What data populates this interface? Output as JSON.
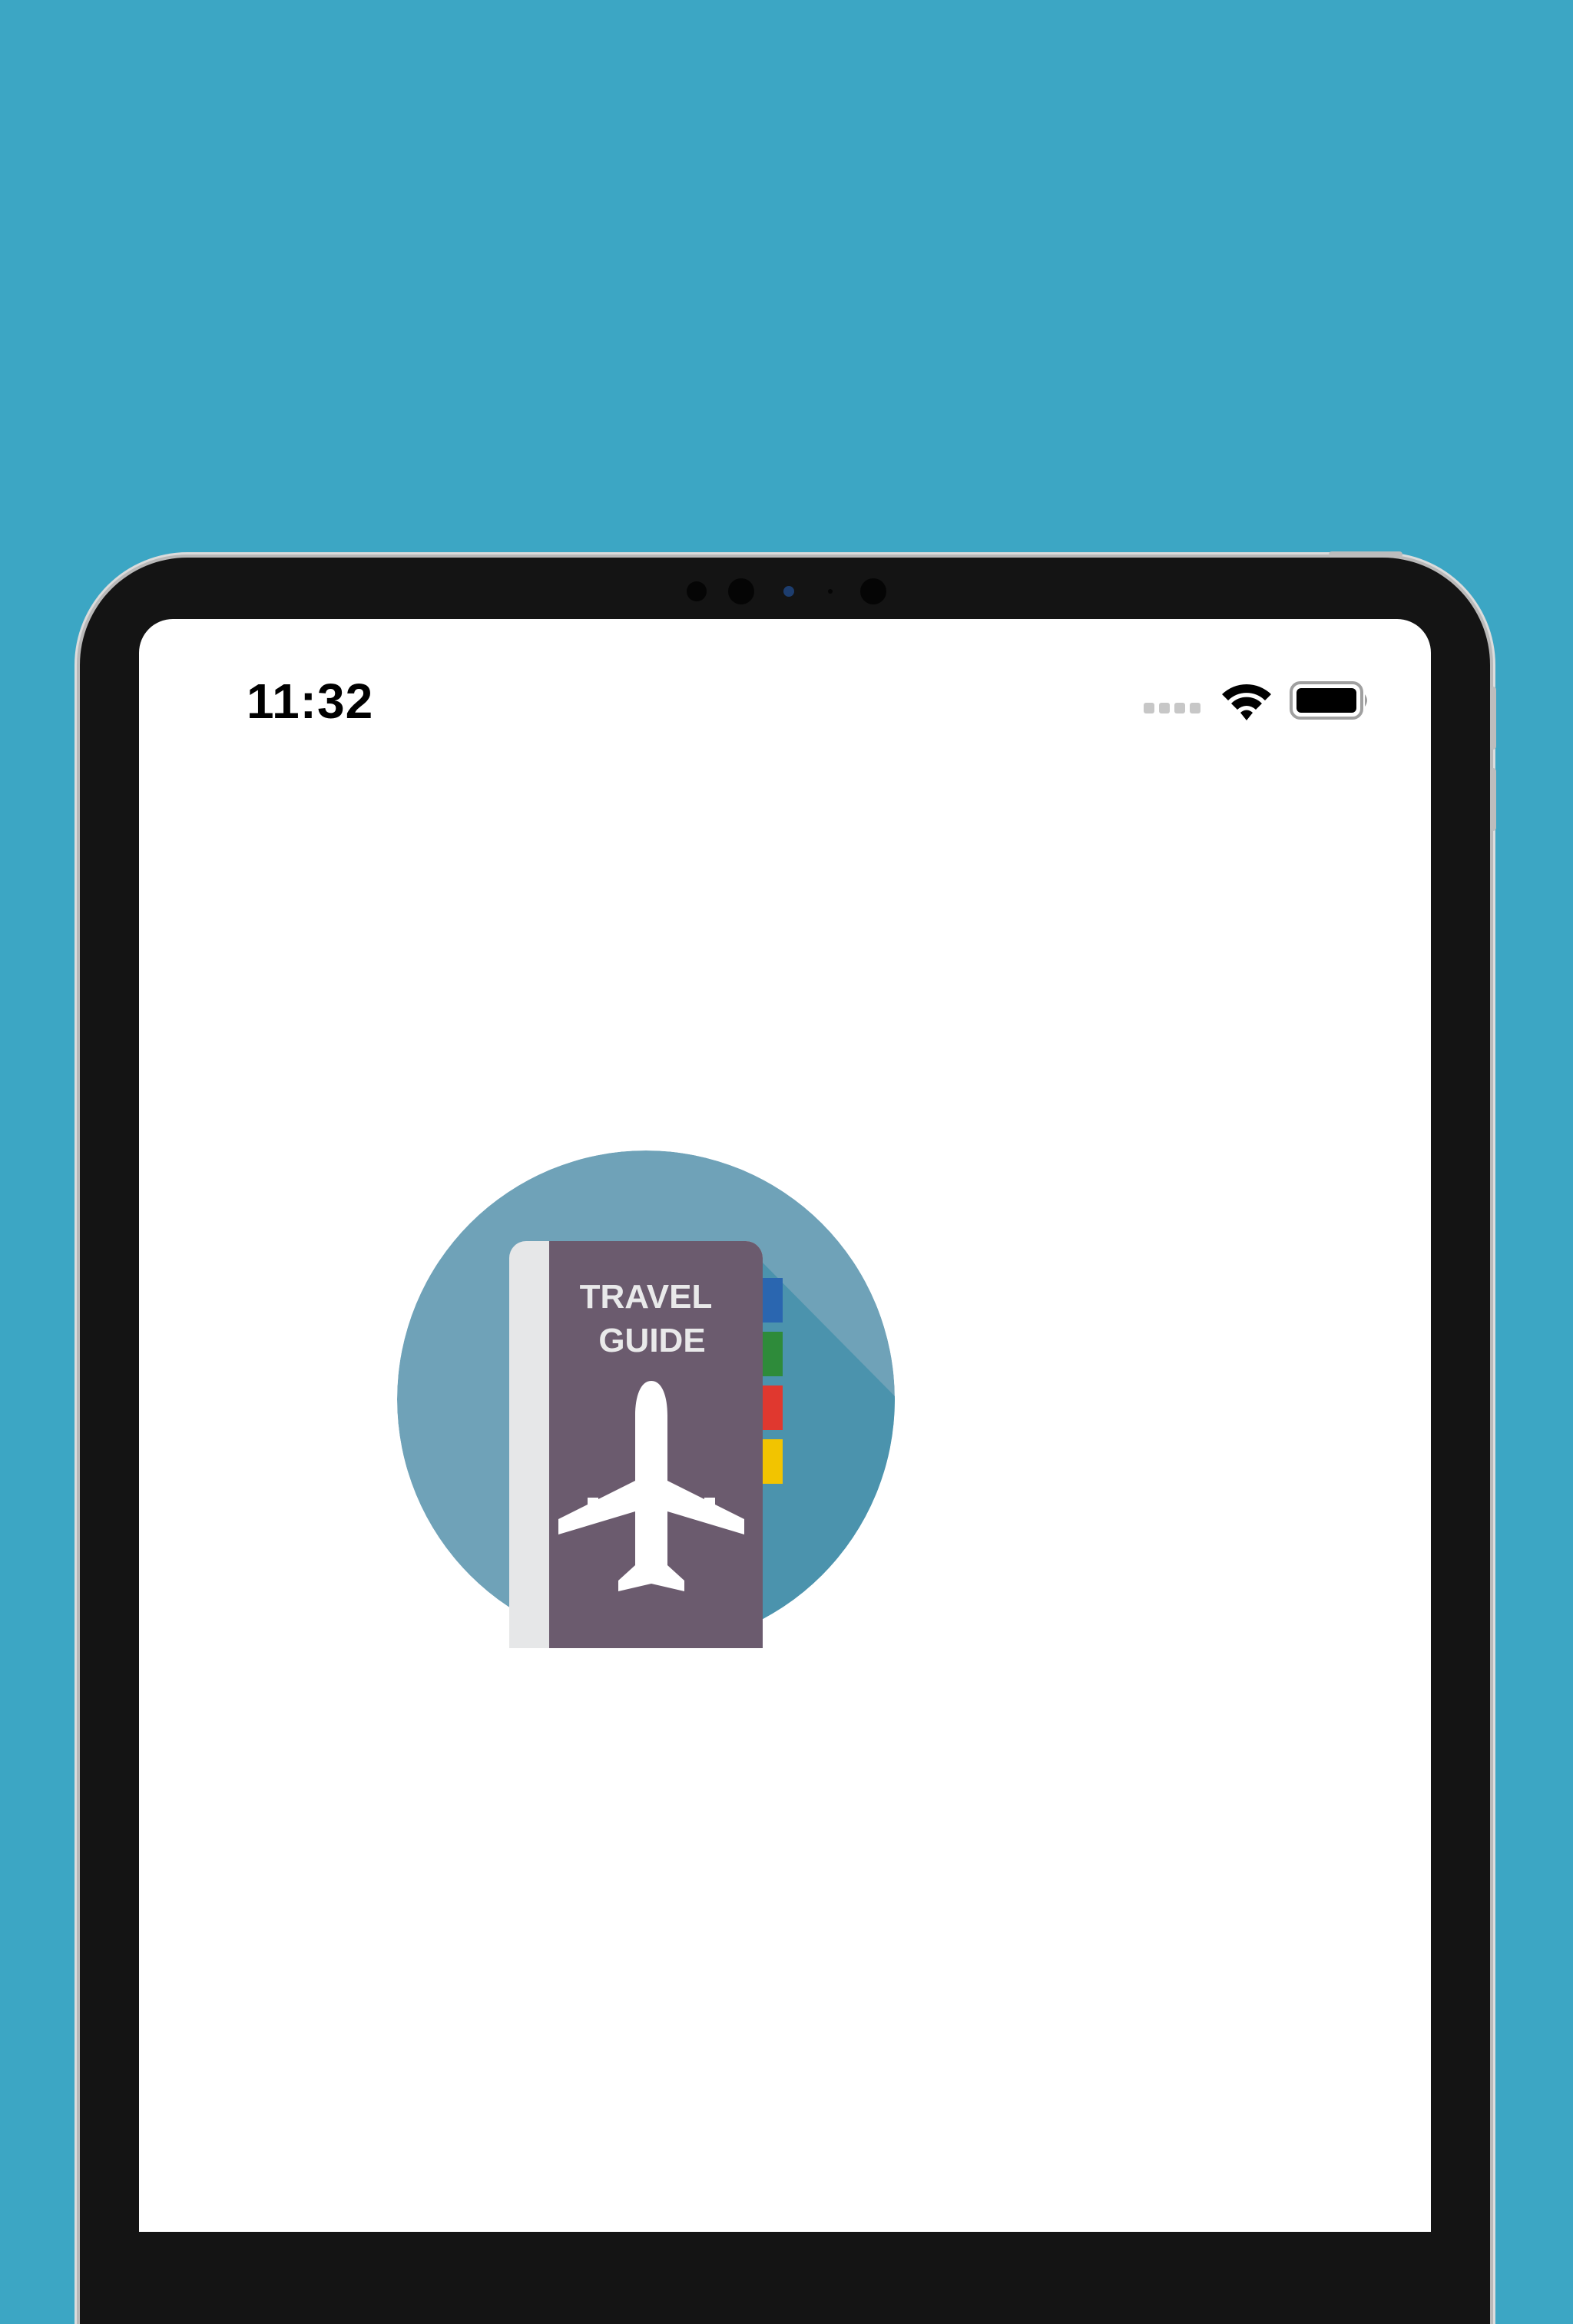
{
  "status_bar": {
    "time": "11:32",
    "icons": [
      "cellular-signal-icon",
      "wifi-icon",
      "battery-icon"
    ]
  },
  "app_logo": {
    "line1": "TRAVEL",
    "line2": "GUIDE",
    "icon": "airplane-icon"
  },
  "colors": {
    "background": "#3ca6c4",
    "device_bezel": "#141414",
    "logo_circle": "#6fa2b8",
    "logo_shadow": "#4b93ad",
    "book_cover": "#6b5b6e",
    "book_spine": "#e6e7e8",
    "tab_blue": "#2a66b0",
    "tab_green": "#2e8b3a",
    "tab_red": "#e0382f",
    "tab_yellow": "#f2c400"
  }
}
